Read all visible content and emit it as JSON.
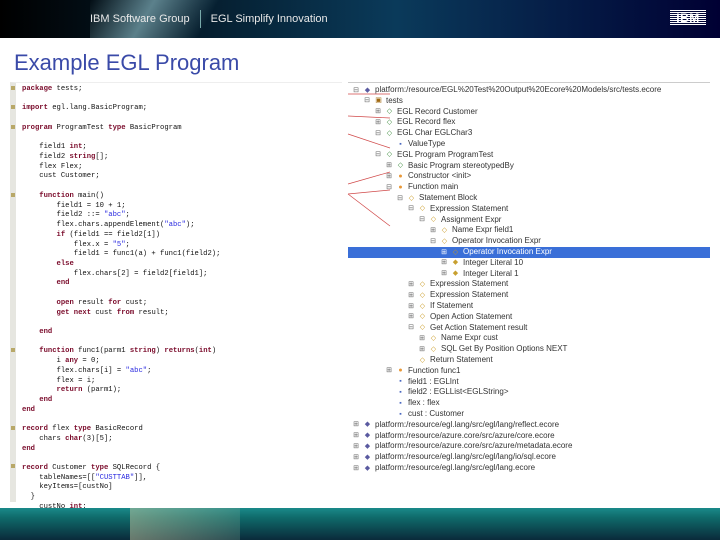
{
  "header": {
    "group": "IBM Software Group",
    "tagline": "EGL Simplify Innovation",
    "logo": "IBM"
  },
  "title": "Example EGL Program",
  "code": [
    {
      "marker": true,
      "kw": "package",
      "rest": " tests;"
    },
    {
      "blank": true
    },
    {
      "marker": true,
      "kw": "import",
      "rest": " egl.lang.BasicProgram;"
    },
    {
      "blank": true
    },
    {
      "marker": true,
      "kw": "program",
      "rest": " ProgramTest ",
      "kw2": "type",
      "rest2": " BasicProgram"
    },
    {
      "blank": true
    },
    {
      "rest": "    field1 ",
      "kw": "int",
      "rest2": ";"
    },
    {
      "rest": "    field2 ",
      "kw": "string",
      "rest2": "[];"
    },
    {
      "rest": "    flex Flex;"
    },
    {
      "rest": "    cust Customer;"
    },
    {
      "blank": true
    },
    {
      "marker": true,
      "rest": "    ",
      "kw": "function",
      "rest2": " main()"
    },
    {
      "rest": "        field1 = 10 + 1;"
    },
    {
      "rest": "        field2 ::= ",
      "str": "\"abc\"",
      "rest2": ";"
    },
    {
      "rest": "        flex.chars.appendElement(",
      "str": "\"abc\"",
      "rest2": ");"
    },
    {
      "rest": "        ",
      "kw": "if",
      "rest2": " (field1 == field2[1])"
    },
    {
      "rest": "            flex.x = ",
      "str": "\"5\"",
      "rest2": ";"
    },
    {
      "rest": "            field1 = func1(a) + func1(field2);"
    },
    {
      "rest": "        ",
      "kw": "else"
    },
    {
      "rest": "            flex.chars[2] = field2[field1];"
    },
    {
      "rest": "        ",
      "kw": "end"
    },
    {
      "blank": true
    },
    {
      "rest": "        ",
      "kw": "open",
      "rest2": " result ",
      "kw2": "for",
      "rest3": " cust;"
    },
    {
      "rest": "        ",
      "kw": "get next",
      "rest2": " cust ",
      "kw2": "from",
      "rest3": " result;"
    },
    {
      "blank": true
    },
    {
      "rest": "    ",
      "kw": "end"
    },
    {
      "blank": true
    },
    {
      "marker": true,
      "rest": "    ",
      "kw": "function",
      "rest2": " func1(parm1 ",
      "kw2": "string",
      "rest3": ") ",
      "kw3": "returns",
      "rest4": "(",
      "kw4": "int",
      "rest5": ")"
    },
    {
      "rest": "        i ",
      "kw": "any",
      "rest2": " = 0;"
    },
    {
      "rest": "        flex.chars[i] = ",
      "str": "\"abc\"",
      "rest2": ";"
    },
    {
      "rest": "        flex = i;"
    },
    {
      "rest": "        ",
      "kw": "return",
      "rest2": " (parm1);"
    },
    {
      "rest": "    ",
      "kw": "end"
    },
    {
      "kw": "end"
    },
    {
      "blank": true
    },
    {
      "marker": true,
      "kw": "record",
      "rest": " flex ",
      "kw2": "type",
      "rest2": " BasicRecord"
    },
    {
      "rest": "    chars ",
      "kw": "char",
      "rest2": "(3)[5];"
    },
    {
      "kw": "end"
    },
    {
      "blank": true
    },
    {
      "marker": true,
      "kw": "record",
      "rest": " Customer ",
      "kw2": "type",
      "rest2": " SQLRecord {"
    },
    {
      "rest": "    tableNames=[[",
      "str": "\"CUSTTAB\"",
      "rest2": "]],"
    },
    {
      "rest": "    keyItems=[custNo]"
    },
    {
      "rest": "  }"
    },
    {
      "rest": "    custNo ",
      "kw": "int",
      "rest2": ";"
    }
  ],
  "tree": [
    {
      "d": 0,
      "t": "-",
      "i": "model",
      "label": "platform:/resource/EGL%20Test%20Output%20Ecore%20Models/src/tests.ecore"
    },
    {
      "d": 1,
      "t": "-",
      "i": "pkg",
      "label": "tests"
    },
    {
      "d": 2,
      "t": "+",
      "i": "cls",
      "label": "EGL Record Customer"
    },
    {
      "d": 2,
      "t": "+",
      "i": "cls",
      "label": "EGL Record flex"
    },
    {
      "d": 2,
      "t": "-",
      "i": "cls",
      "label": "EGL Char EGLChar3"
    },
    {
      "d": 3,
      "t": "",
      "i": "attr",
      "label": "ValueType"
    },
    {
      "d": 2,
      "t": "-",
      "i": "cls",
      "label": "EGL Program ProgramTest"
    },
    {
      "d": 3,
      "t": "+",
      "i": "cls",
      "label": "Basic Program stereotypedBy"
    },
    {
      "d": 3,
      "t": "+",
      "i": "op",
      "label": "Constructor <init>"
    },
    {
      "d": 3,
      "t": "-",
      "i": "op",
      "label": "Function main"
    },
    {
      "d": 4,
      "t": "-",
      "i": "cls-gold",
      "label": "Statement Block"
    },
    {
      "d": 5,
      "t": "-",
      "i": "cls-gold",
      "label": "Expression Statement"
    },
    {
      "d": 6,
      "t": "-",
      "i": "cls-gold",
      "label": "Assignment Expr"
    },
    {
      "d": 7,
      "t": "+",
      "i": "cls-gold",
      "label": "Name Expr field1"
    },
    {
      "d": 7,
      "t": "-",
      "i": "cls-gold",
      "label": "Operator Invocation Expr"
    },
    {
      "d": 8,
      "t": "+",
      "i": "cls-gold",
      "label": "Operator Invocation Expr",
      "selected": true
    },
    {
      "d": 8,
      "t": "+",
      "i": "lit",
      "label": "Integer Literal 10"
    },
    {
      "d": 8,
      "t": "+",
      "i": "lit",
      "label": "Integer Literal 1"
    },
    {
      "d": 5,
      "t": "+",
      "i": "cls-gold",
      "label": "Expression Statement"
    },
    {
      "d": 5,
      "t": "+",
      "i": "cls-gold",
      "label": "Expression Statement"
    },
    {
      "d": 5,
      "t": "+",
      "i": "cls-gold",
      "label": "If Statement"
    },
    {
      "d": 5,
      "t": "+",
      "i": "cls-gold",
      "label": "Open Action Statement"
    },
    {
      "d": 5,
      "t": "-",
      "i": "cls-gold",
      "label": "Get Action Statement result"
    },
    {
      "d": 6,
      "t": "+",
      "i": "cls-gold",
      "label": "Name Expr cust"
    },
    {
      "d": 6,
      "t": "+",
      "i": "cls-gold",
      "label": "SQL Get By Position Options NEXT"
    },
    {
      "d": 5,
      "t": "",
      "i": "cls-gold",
      "label": "Return Statement"
    },
    {
      "d": 3,
      "t": "+",
      "i": "op",
      "label": "Function func1"
    },
    {
      "d": 3,
      "t": "",
      "i": "attr",
      "label": "field1 : EGLInt"
    },
    {
      "d": 3,
      "t": "",
      "i": "attr",
      "label": "field2 : EGLList<EGLString>"
    },
    {
      "d": 3,
      "t": "",
      "i": "attr",
      "label": "flex : flex"
    },
    {
      "d": 3,
      "t": "",
      "i": "attr",
      "label": "cust : Customer"
    },
    {
      "d": 0,
      "t": "+",
      "i": "model",
      "label": "platform:/resource/egl.lang/src/egl/lang/reflect.ecore"
    },
    {
      "d": 0,
      "t": "+",
      "i": "model",
      "label": "platform:/resource/azure.core/src/azure/core.ecore"
    },
    {
      "d": 0,
      "t": "+",
      "i": "model",
      "label": "platform:/resource/azure.core/src/azure/metadata.ecore"
    },
    {
      "d": 0,
      "t": "+",
      "i": "model",
      "label": "platform:/resource/egl.lang/src/egl/lang/io/sql.ecore"
    },
    {
      "d": 0,
      "t": "+",
      "i": "model",
      "label": "platform:/resource/egl.lang/src/egl/lang.ecore"
    }
  ]
}
